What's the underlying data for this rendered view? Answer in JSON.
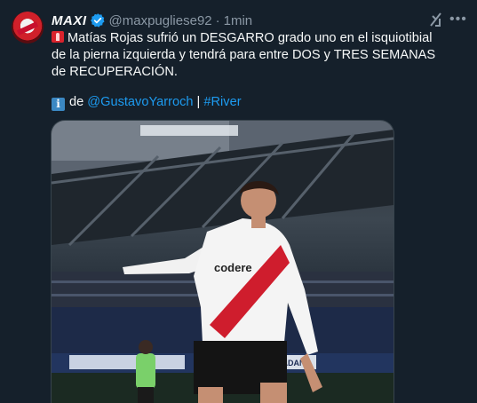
{
  "tweet": {
    "author": {
      "display_name": "MAXI",
      "handle": "@maxpugliese92",
      "separator": "·",
      "time": "1min"
    },
    "text": "Matías Rojas sufrió un DESGARRO grado uno en el isquiotibial de la pierna izquierda y tendrá para entre DOS y TRES SEMANAS de RECUPERACIÓN.",
    "source": {
      "prefix": "de",
      "mention": "@GustavoYarroch",
      "divider": "|",
      "hashtag": "#River"
    },
    "media": {
      "sponsor_text": "codere",
      "ad_board_text": "DADANA"
    }
  },
  "icons": [
    "siren-icon",
    "information-icon",
    "verified-badge-icon",
    "grok-icon",
    "more-options-icon"
  ],
  "colors": {
    "background": "#15202b",
    "link": "#1d9bf0",
    "muted": "#8b98a5",
    "verified": "#1d9bf0"
  }
}
